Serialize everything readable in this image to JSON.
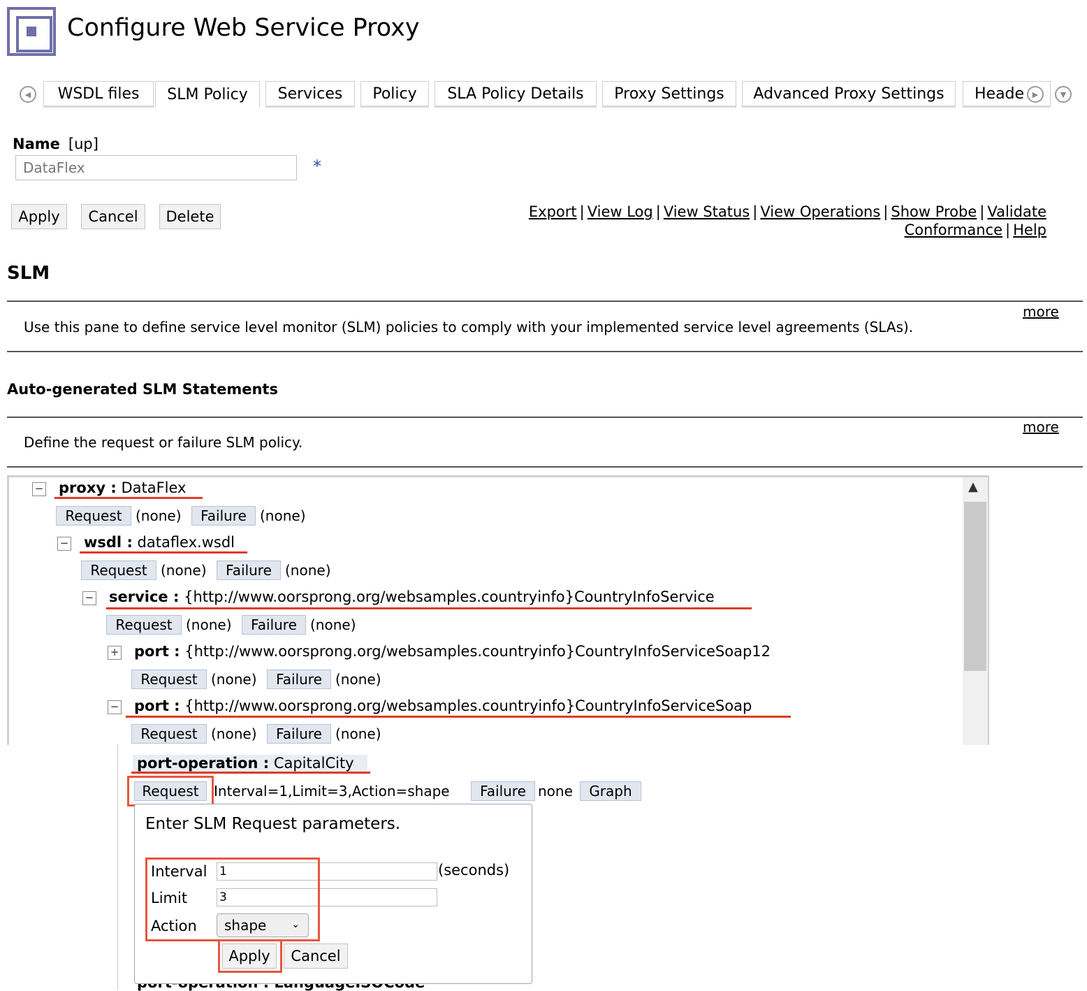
{
  "header": {
    "title": "Configure Web Service Proxy"
  },
  "tabs": {
    "items": [
      {
        "label": "WSDL files"
      },
      {
        "label": "SLM Policy"
      },
      {
        "label": "Services"
      },
      {
        "label": "Policy"
      },
      {
        "label": "SLA Policy Details"
      },
      {
        "label": "Proxy Settings"
      },
      {
        "label": "Advanced Proxy Settings"
      },
      {
        "label": "Heade"
      }
    ],
    "active": "SLM Policy"
  },
  "name": {
    "label": "Name",
    "status": "[up]",
    "value": "DataFlex",
    "required": "*"
  },
  "actions": {
    "apply": "Apply",
    "cancel": "Cancel",
    "delete": "Delete"
  },
  "links": {
    "export": "Export",
    "view_log": "View Log",
    "view_status": "View Status",
    "view_operations": "View Operations",
    "show_probe": "Show Probe",
    "validate": "Validate",
    "conformance": "Conformance",
    "help": "Help",
    "sep": "|"
  },
  "slm": {
    "heading": "SLM",
    "description": "Use this pane to define service level monitor (SLM) policies to comply with your implemented service level agreements (SLAs).",
    "more": "more"
  },
  "auto": {
    "heading": "Auto-generated SLM Statements",
    "description": "Define the request or failure SLM policy.",
    "more": "more"
  },
  "tree": {
    "request": "Request",
    "failure": "Failure",
    "none_paren": "(none)",
    "graph": "Graph",
    "proxy": {
      "key": "proxy :",
      "value": "DataFlex"
    },
    "wsdl": {
      "key": "wsdl :",
      "value": "dataflex.wsdl"
    },
    "service": {
      "key": "service :",
      "value": "{http://www.oorsprong.org/websamples.countryinfo}CountryInfoService"
    },
    "port1": {
      "key": "port :",
      "value": "{http://www.oorsprong.org/websamples.countryinfo}CountryInfoServiceSoap12"
    },
    "port2": {
      "key": "port :",
      "value": "{http://www.oorsprong.org/websamples.countryinfo}CountryInfoServiceSoap"
    },
    "operation": {
      "key": "port-operation :",
      "value": "CapitalCity",
      "request_value": "Interval=1,Limit=3,Action=shape",
      "failure_value": "none"
    },
    "next_operation": "port-operation : LanguageISOCode"
  },
  "popup": {
    "title": "Enter SLM Request parameters.",
    "interval_label": "Interval",
    "interval_value": "1",
    "interval_unit": "(seconds)",
    "limit_label": "Limit",
    "limit_value": "3",
    "action_label": "Action",
    "action_value": "shape",
    "apply": "Apply",
    "cancel": "Cancel"
  },
  "colors": {
    "accent": "#6f6fa9",
    "highlight": "#e8563f",
    "chip_bg": "#e1e6ef"
  },
  "icons": [
    "prev-tab-icon",
    "next-tab-icon",
    "tab-menu-icon",
    "collapse-icon",
    "expand-icon",
    "chevron-down-icon",
    "scroll-up-icon"
  ]
}
